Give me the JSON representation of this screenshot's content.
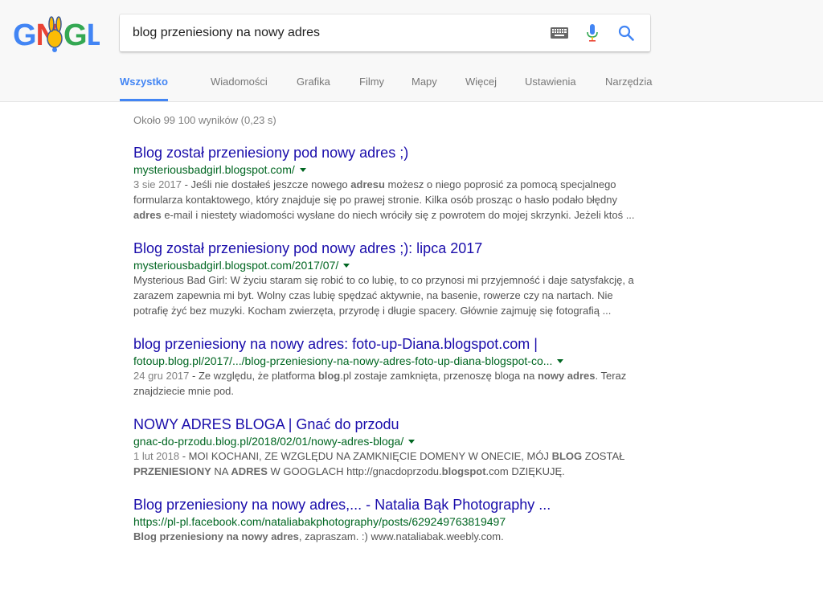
{
  "logo": {
    "alt": "Google Doodle"
  },
  "search": {
    "query": "blog przeniesiony na nowy adres"
  },
  "icons": {
    "keyboard": "keyboard-icon",
    "mic": "mic-icon",
    "search": "search-icon"
  },
  "colors": {
    "accent": "#4285f4",
    "link": "#1a0dab",
    "url": "#006621",
    "snippet": "#545454"
  },
  "tabs": [
    {
      "label": "Wszystko",
      "active": true
    },
    {
      "label": "Wiadomości"
    },
    {
      "label": "Grafika"
    },
    {
      "label": "Filmy"
    },
    {
      "label": "Mapy"
    },
    {
      "label": "Więcej"
    },
    {
      "label": "Ustawienia"
    },
    {
      "label": "Narzędzia"
    }
  ],
  "stats": "Około 99 100 wyników (0,23 s)",
  "results": [
    {
      "title": "Blog został przeniesiony pod nowy adres ;)",
      "url": "mysteriousbadgirl.blogspot.com/",
      "has_caret": true,
      "date": "3 sie 2017",
      "snippet": [
        " - Jeśli nie dostałeś jeszcze nowego ",
        {
          "b": "adresu"
        },
        " możesz o niego poprosić za pomocą specjalnego formularza kontaktowego, który znajduje się po prawej stronie. Kilka osób prosząc o hasło podało błędny ",
        {
          "b": "adres"
        },
        " e-mail i niestety wiadomości wysłane do niech wróciły się z powrotem do mojej skrzynki. Jeżeli ktoś ..."
      ]
    },
    {
      "title": "Blog został przeniesiony pod nowy adres ;): lipca 2017",
      "url": "mysteriousbadgirl.blogspot.com/2017/07/",
      "has_caret": true,
      "date": "",
      "snippet": [
        "Mysterious Bad Girl: W życiu staram się robić to co lubię, to co przynosi mi przyjemność i daje satysfakcję, a zarazem zapewnia mi byt. Wolny czas lubię spędzać aktywnie, na basenie, rowerze czy na nartach. Nie potrafię żyć bez muzyki. Kocham zwierzęta, przyrodę i długie spacery. Głównie zajmuję się fotografią ..."
      ]
    },
    {
      "title": "blog przeniesiony na nowy adres: foto-up-Diana.blogspot.com |",
      "url": "fotoup.blog.pl/2017/.../blog-przeniesiony-na-nowy-adres-foto-up-diana-blogspot-co...",
      "has_caret": true,
      "date": "24 gru 2017",
      "snippet": [
        " - Ze względu, że platforma ",
        {
          "b": "blog"
        },
        ".pl zostaje zamknięta, przenoszę bloga na ",
        {
          "b": "nowy adres"
        },
        ". Teraz znajdziecie mnie pod."
      ]
    },
    {
      "title": "NOWY ADRES BLOGA | Gnać do przodu",
      "url": "gnac-do-przodu.blog.pl/2018/02/01/nowy-adres-bloga/",
      "has_caret": true,
      "date": "1 lut 2018",
      "snippet": [
        " - MOI KOCHANI, ZE WZGLĘDU NA ZAMKNIĘCIE DOMENY W ONECIE, MÓJ ",
        {
          "b": "BLOG"
        },
        " ZOSTAŁ ",
        {
          "b": "PRZENIESIONY"
        },
        " NA ",
        {
          "b": "ADRES"
        },
        " W GOOGLACH http://gnacdoprzodu.",
        {
          "b": "blogspot"
        },
        ".com DZIĘKUJĘ."
      ]
    },
    {
      "title": "Blog przeniesiony na nowy adres,... - Natalia Bąk Photography ...",
      "url": "https://pl-pl.facebook.com/nataliabakphotography/posts/629249763819497",
      "has_caret": false,
      "date": "",
      "snippet": [
        {
          "b": "Blog przeniesiony na nowy adres"
        },
        ", zapraszam. :) www.nataliabak.weebly.com."
      ]
    }
  ]
}
